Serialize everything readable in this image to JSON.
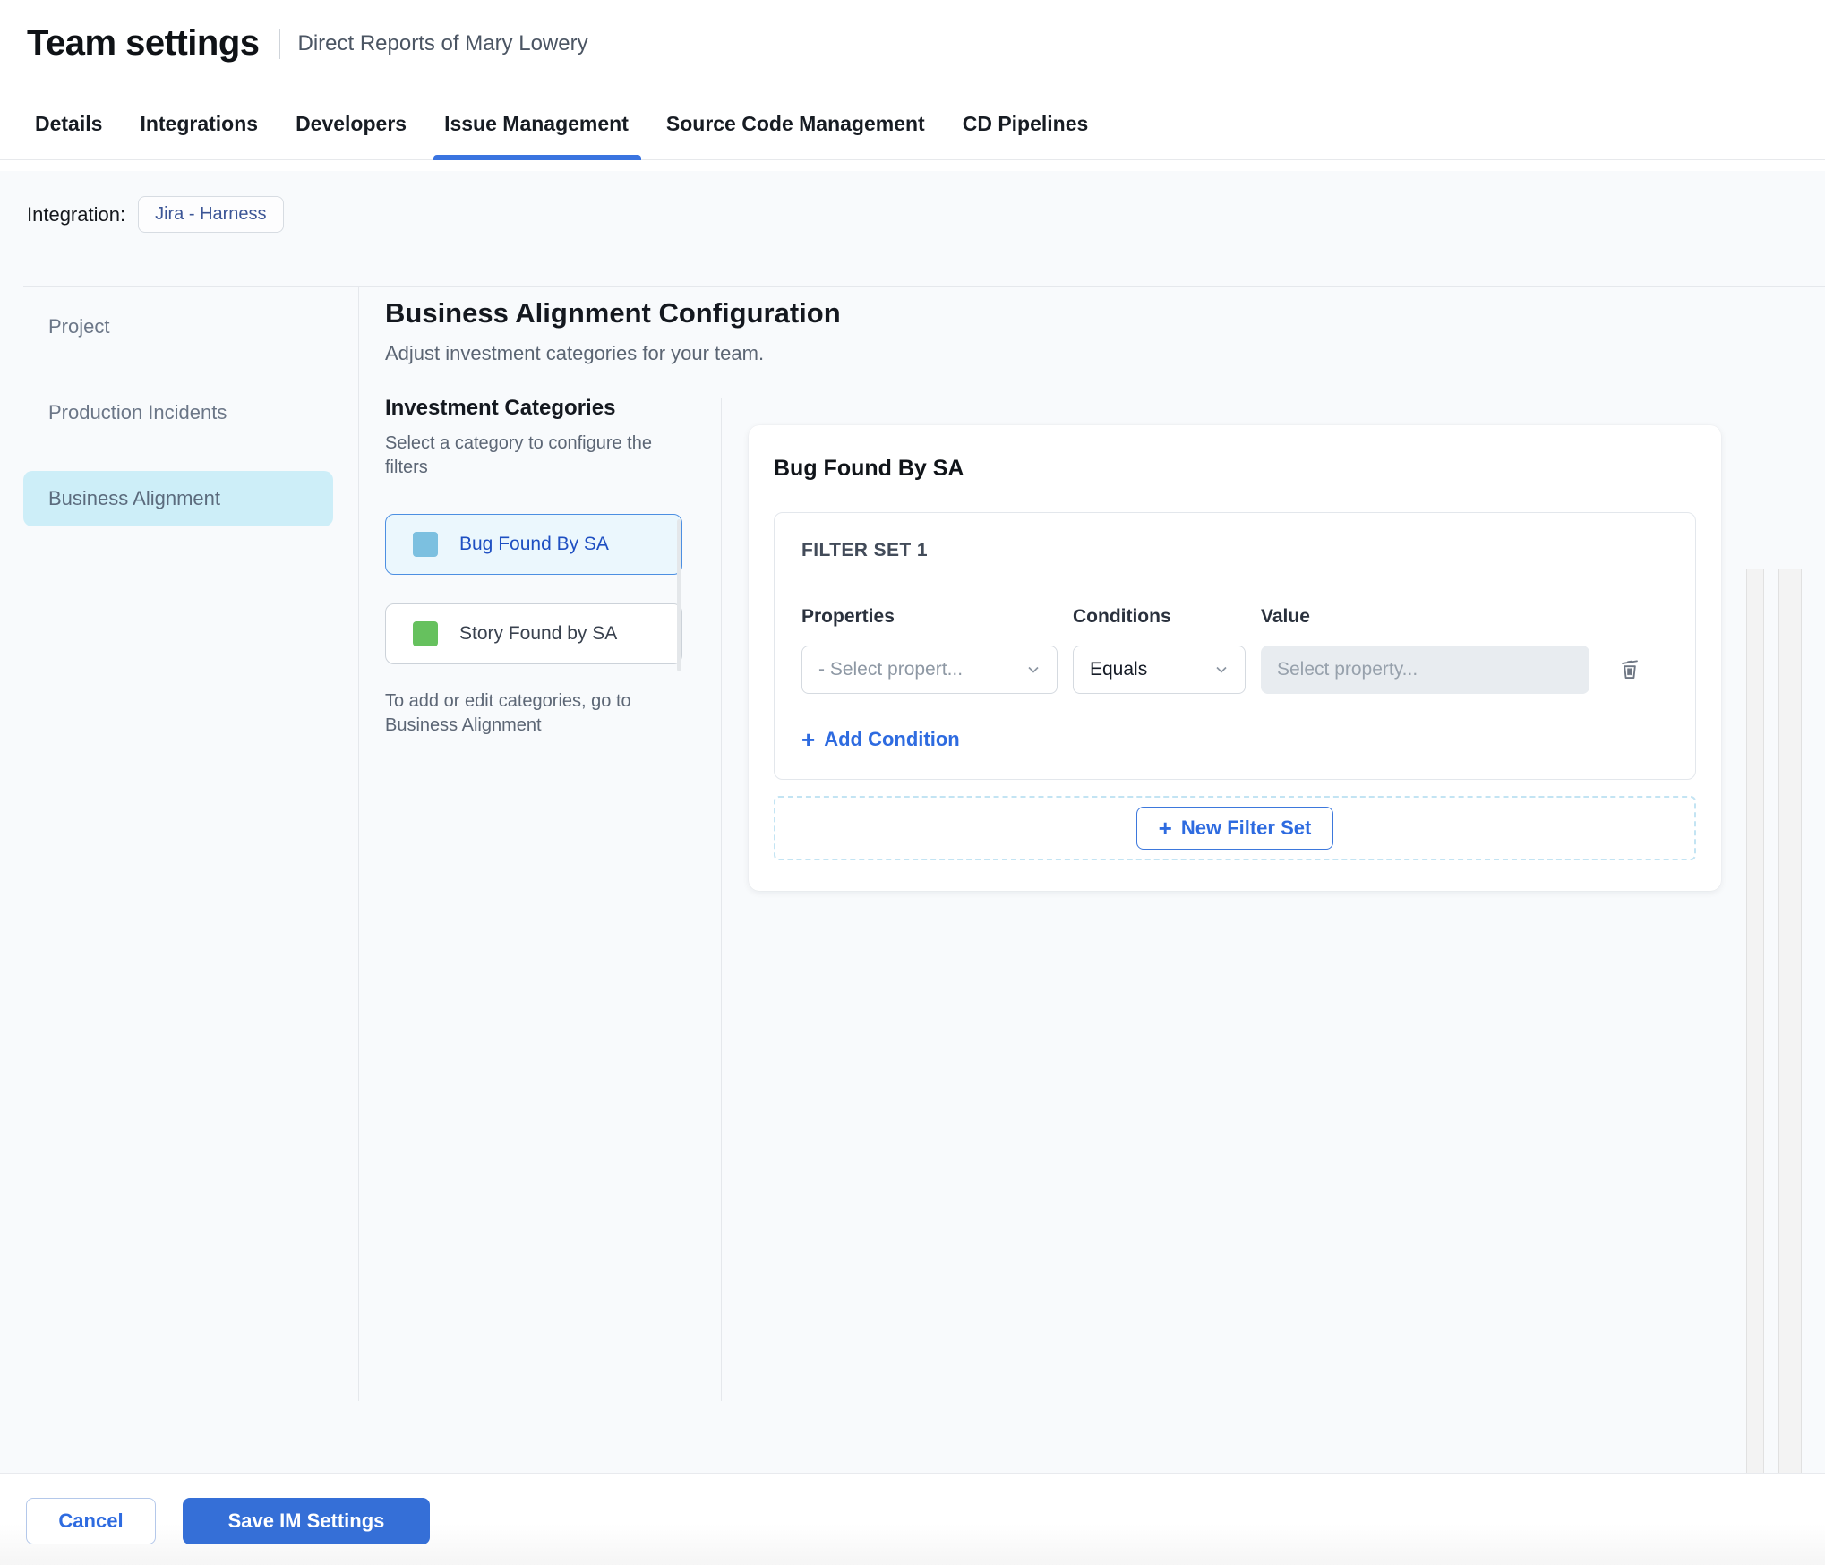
{
  "header": {
    "title": "Team settings",
    "subtitle": "Direct Reports of Mary Lowery"
  },
  "tabs": [
    {
      "label": "Details",
      "active": false
    },
    {
      "label": "Integrations",
      "active": false
    },
    {
      "label": "Developers",
      "active": false
    },
    {
      "label": "Issue Management",
      "active": true
    },
    {
      "label": "Source Code Management",
      "active": false
    },
    {
      "label": "CD Pipelines",
      "active": false
    }
  ],
  "integration": {
    "label": "Integration:",
    "value": "Jira - Harness"
  },
  "sidebar": {
    "items": [
      {
        "label": "Project",
        "active": false
      },
      {
        "label": "Production Incidents",
        "active": false
      },
      {
        "label": "Business Alignment",
        "active": true
      }
    ]
  },
  "main": {
    "title": "Business Alignment Configuration",
    "subtitle": "Adjust investment categories for your team.",
    "categories": {
      "heading": "Investment Categories",
      "description": "Select a category to configure the filters",
      "items": [
        {
          "label": "Bug Found By SA",
          "swatch_color": "#7cc0e0",
          "selected": true
        },
        {
          "label": "Story Found by SA",
          "swatch_color": "#66c15e",
          "selected": false
        }
      ],
      "note": "To add or edit categories, go to Business Alignment"
    },
    "panel": {
      "title": "Bug Found By SA",
      "filter_set": {
        "label": "FILTER SET 1",
        "columns": {
          "properties": "Properties",
          "conditions": "Conditions",
          "value": "Value"
        },
        "properties_placeholder": "- Select propert...",
        "conditions_value": "Equals",
        "value_placeholder": "Select property...",
        "add_condition": "Add Condition"
      },
      "new_filter_set": "New Filter Set"
    }
  },
  "footer": {
    "cancel": "Cancel",
    "save": "Save IM Settings"
  },
  "colors": {
    "accent_blue": "#2e6be0",
    "tab_underline": "#3a74e0",
    "save_button_bg": "#356fd7",
    "selected_category_bg": "#ebf7fd",
    "selected_category_border": "#4c8fe2",
    "selected_category_text": "#1e4fc2",
    "sidebar_selected_bg": "#cdeef8",
    "bug_swatch": "#7cc0e0",
    "story_swatch": "#66c15e",
    "page_bg": "#f8fafc",
    "disabled_input_bg": "#e8ecf0"
  }
}
